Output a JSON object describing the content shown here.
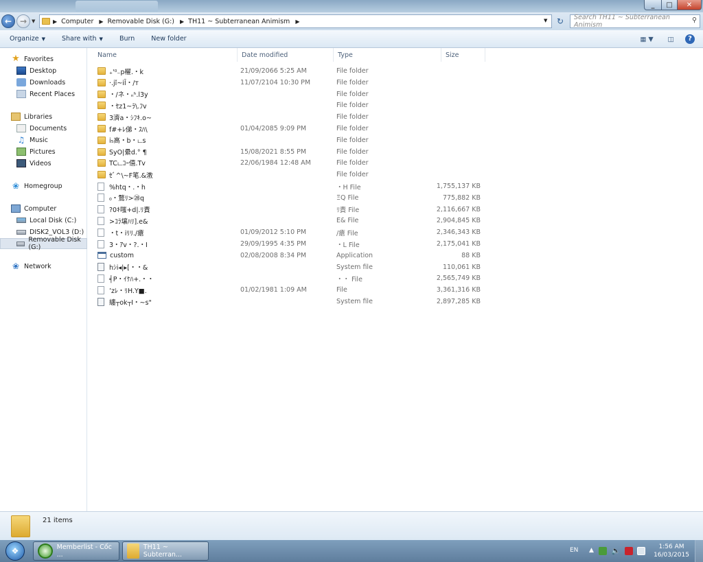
{
  "address": {
    "crumbs": [
      "Computer",
      "Removable Disk (G:)",
      "TH11 ~ Subterranean Animism"
    ],
    "search_placeholder": "Search TH11 ~ Subterranean Animism"
  },
  "toolbar": {
    "organize": "Organize",
    "share_with": "Share with",
    "burn": "Burn",
    "new_folder": "New folder"
  },
  "nav": {
    "favorites": "Favorites",
    "desktop": "Desktop",
    "downloads": "Downloads",
    "recent_places": "Recent Places",
    "libraries": "Libraries",
    "documents": "Documents",
    "music": "Music",
    "pictures": "Pictures",
    "videos": "Videos",
    "homegroup": "Homegroup",
    "computer": "Computer",
    "local_disk": "Local Disk (C:)",
    "disk2": "DISK2_VOL3 (D:)",
    "removable": "Removable Disk (G:)",
    "network": "Network"
  },
  "columns": {
    "name": "Name",
    "date": "Date modified",
    "type": "Type",
    "size": "Size"
  },
  "files": [
    {
      "icon": "folder",
      "name": "₊'⁰₋p櫂.・k",
      "date": "21/09/2066 5:25 AM",
      "type": "File folder",
      "size": ""
    },
    {
      "icon": "folder",
      "name": "·.jǐ~iĪ・/т",
      "date": "11/07/2104 10:30 PM",
      "type": "File folder",
      "size": ""
    },
    {
      "icon": "folder",
      "name": "・/ネ・ₙʰ.l3y",
      "date": "",
      "type": "File folder",
      "size": ""
    },
    {
      "icon": "folder",
      "name": "・ｾz1~ﾗ\\.ﾌv",
      "date": "",
      "type": "File folder",
      "size": ""
    },
    {
      "icon": "folder",
      "name": "3濟a・ｼﾌｷ.o~",
      "date": "",
      "type": "File folder",
      "size": ""
    },
    {
      "icon": "folder",
      "name": "f#+ﾚ俤・ｽﾊ\\",
      "date": "01/04/2085 9:09 PM",
      "type": "File folder",
      "size": ""
    },
    {
      "icon": "folder",
      "name": "i₅高・b・டs",
      "date": "",
      "type": "File folder",
      "size": ""
    },
    {
      "icon": "folder",
      "name": "SyO|纍d.° ¶",
      "date": "15/08/2021 8:55 PM",
      "type": "File folder",
      "size": ""
    },
    {
      "icon": "folder",
      "name": "TCடｺｰ僖.Tv",
      "date": "22/06/1984 12:48 AM",
      "type": "File folder",
      "size": ""
    },
    {
      "icon": "folder",
      "name": "ｾﾞ^\\~F笔.&漖",
      "date": "",
      "type": "File folder",
      "size": ""
    },
    {
      "icon": "file",
      "name": "%htq・.・h",
      "date": "",
      "type": "・H File",
      "size": "1,755,137 KB"
    },
    {
      "icon": "file",
      "name": "₀・鶩ﾘ>㉘q",
      "date": "",
      "type": "ΞQ File",
      "size": "775,882 KB"
    },
    {
      "icon": "file",
      "name": "?0ｷ嗤+d|.ﾘ責",
      "date": "",
      "type": "ﾘ責 File",
      "size": "2,116,667 KB"
    },
    {
      "icon": "file",
      "name": ">ｺﾗ壌ﾊﾘ].e&",
      "date": "",
      "type": "E& File",
      "size": "2,904,845 KB"
    },
    {
      "icon": "file",
      "name": "・t・iﾘﾘ./瘡",
      "date": "01/09/2012 5:10 PM",
      "type": "/瘡 File",
      "size": "2,346,343 KB"
    },
    {
      "icon": "file",
      "name": "3・ｱv・?.・I",
      "date": "29/09/1995 4:35 PM",
      "type": "・L File",
      "size": "2,175,041 KB"
    },
    {
      "icon": "app",
      "name": "custom",
      "date": "02/08/2008 8:34 PM",
      "type": "Application",
      "size": "88 KB"
    },
    {
      "icon": "sys",
      "name": "hｼi◂|▸[・・&",
      "date": "",
      "type": "System file",
      "size": "110,061 KB"
    },
    {
      "icon": "file",
      "name": "╡P・ｲｹﾊ+.・・",
      "date": "",
      "type": "・・ File",
      "size": "2,565,749 KB"
    },
    {
      "icon": "file",
      "name": "’zﾚ・ﾘH.Y■.",
      "date": "01/02/1981 1:09 AM",
      "type": "File",
      "size": "3,361,316 KB"
    },
    {
      "icon": "sys",
      "name": "纏┬ok┬Ⅰ・~s\"",
      "date": "",
      "type": "System file",
      "size": "2,897,285 KB"
    }
  ],
  "status": {
    "count": "21 items"
  },
  "taskbar": {
    "item1": "Memberlist - Cốc ...",
    "item2": "TH11 ~ Subterran...",
    "lang": "EN",
    "time": "1:56 AM",
    "date": "16/03/2015"
  }
}
